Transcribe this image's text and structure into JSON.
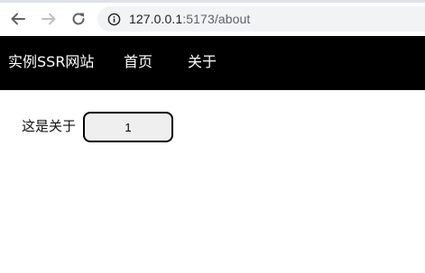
{
  "browser": {
    "url_host": "127.0.0.1",
    "url_rest": ":5173/about",
    "icons": {
      "back": "arrow-left",
      "forward": "arrow-right",
      "reload": "reload",
      "site_info": "info-circle"
    }
  },
  "navbar": {
    "brand": "实例SSR网站",
    "links": [
      {
        "label": "首页"
      },
      {
        "label": "关于"
      }
    ],
    "background": "#000000",
    "text_color": "#ffffff"
  },
  "main": {
    "about_text": "这是关于",
    "count_button_label": "1"
  }
}
